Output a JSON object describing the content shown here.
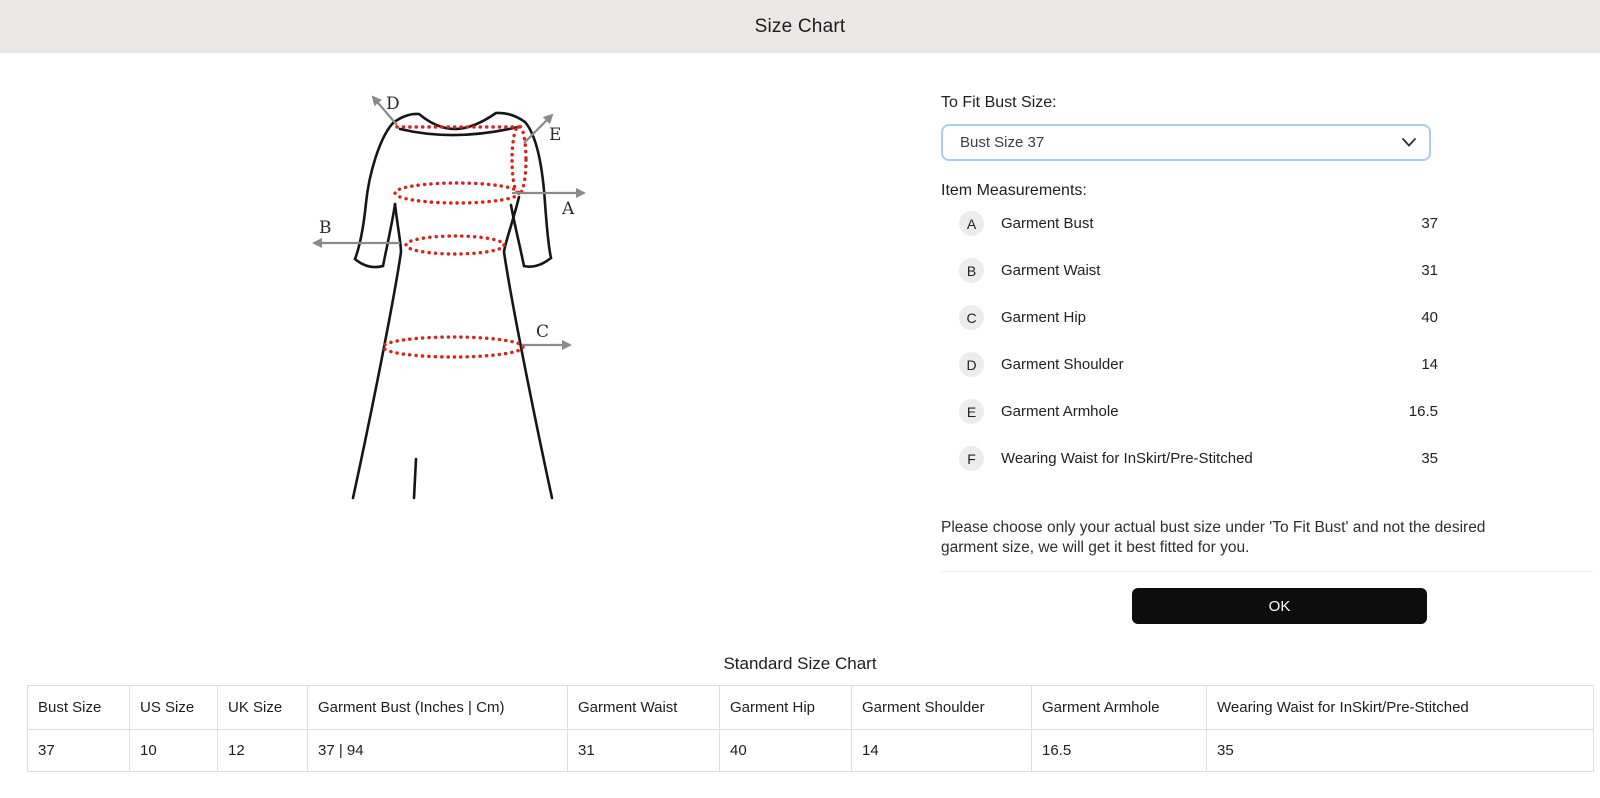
{
  "header": {
    "title": "Size Chart"
  },
  "fit": {
    "label": "To Fit Bust Size:",
    "selected": "Bust Size 37"
  },
  "measurements": {
    "heading": "Item Measurements:",
    "rows": [
      {
        "badge": "A",
        "label": "Garment Bust",
        "value": "37"
      },
      {
        "badge": "B",
        "label": "Garment Waist",
        "value": "31"
      },
      {
        "badge": "C",
        "label": "Garment Hip",
        "value": "40"
      },
      {
        "badge": "D",
        "label": "Garment Shoulder",
        "value": "14"
      },
      {
        "badge": "E",
        "label": "Garment Armhole",
        "value": "16.5"
      },
      {
        "badge": "F",
        "label": "Wearing Waist for InSkirt/Pre-Stitched",
        "value": "35"
      }
    ]
  },
  "note": "Please choose only your actual bust size under 'To Fit Bust' and not the desired garment size, we will get it best fitted for you.",
  "ok_label": "OK",
  "size_chart": {
    "title": "Standard Size Chart",
    "columns": [
      "Bust Size",
      "US Size",
      "UK Size",
      "Garment Bust (Inches | Cm)",
      "Garment Waist",
      "Garment Hip",
      "Garment Shoulder",
      "Garment Armhole",
      "Wearing Waist for InSkirt/Pre-Stitched"
    ],
    "rows": [
      [
        "37",
        "10",
        "12",
        "37 | 94",
        "31",
        "40",
        "14",
        "16.5",
        "35"
      ]
    ]
  },
  "diagram": {
    "labels": [
      "A",
      "B",
      "C",
      "D",
      "E"
    ]
  },
  "colors": {
    "header_bg": "#ebe7e6",
    "accent_red": "#d7231d",
    "arrow_gray": "#8a8a8a",
    "select_border": "#a9cdee",
    "button_bg": "#0d0d0d",
    "table_border": "#dddddd"
  }
}
